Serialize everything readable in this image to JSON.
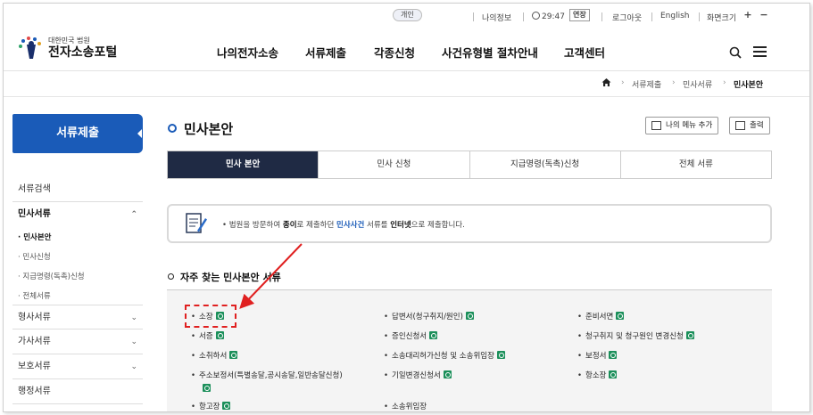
{
  "util": {
    "user_type": "개인",
    "my_info": "나의정보",
    "timer": "29:47",
    "extend": "연장",
    "logout": "로그아웃",
    "english": "English",
    "zoom_label": "화면크기",
    "zoom_in": "+",
    "zoom_out": "−"
  },
  "logo": {
    "sub": "대한민국 법원",
    "main": "전자소송포털"
  },
  "gnb": [
    "나의전자소송",
    "서류제출",
    "각종신청",
    "사건유형별 절차안내",
    "고객센터"
  ],
  "breadcrumb": [
    "서류제출",
    "민사서류",
    "민사본안"
  ],
  "sidebar": {
    "title": "서류제출",
    "items": [
      {
        "label": "서류검색"
      },
      {
        "label": "민사서류"
      },
      {
        "label": "형사서류"
      },
      {
        "label": "가사서류"
      },
      {
        "label": "보호서류"
      },
      {
        "label": "행정서류"
      }
    ],
    "sub_items": [
      "민사본안",
      "민사신청",
      "지급명령(독촉)신청",
      "전체서류"
    ],
    "expanded_chevron": "⌃",
    "collapsed_chevron": "⌄"
  },
  "page": {
    "title": "민사본안",
    "my_menu_button": "나의 메뉴 추가",
    "print_button": "출력"
  },
  "tabs": [
    "민사 본안",
    "민사 신청",
    "지급명령(독촉)신청",
    "전체 서류"
  ],
  "notice": {
    "t1": "• 법원을 방문하여 ",
    "b1": "종이",
    "t2": "로 제출하던 ",
    "b2": "민사사건",
    "t3": " 서류를 ",
    "b3": "인터넷",
    "t4": "으로 제출합니다."
  },
  "section_title": "자주 찾는 민사본안 서류",
  "documents": {
    "col1": [
      "소장",
      "서증",
      "소취하서",
      "주소보정서(특별송달,공시송달,일반송달신청)",
      "항고장"
    ],
    "col2": [
      "답변서(청구취지/원인)",
      "증인신청서",
      "소송대리허가신청 및 소송위임장",
      "기일변경신청서",
      "소송위임장"
    ],
    "col3": [
      "준비서면",
      "청구취지 및 청구원인 변경신청",
      "보정서",
      "항소장"
    ]
  },
  "colors": {
    "accent_blue": "#1a5bb8",
    "tab_active": "#1f2a44",
    "highlight_red": "#e02020",
    "e_icon": "#1b8f5a"
  }
}
